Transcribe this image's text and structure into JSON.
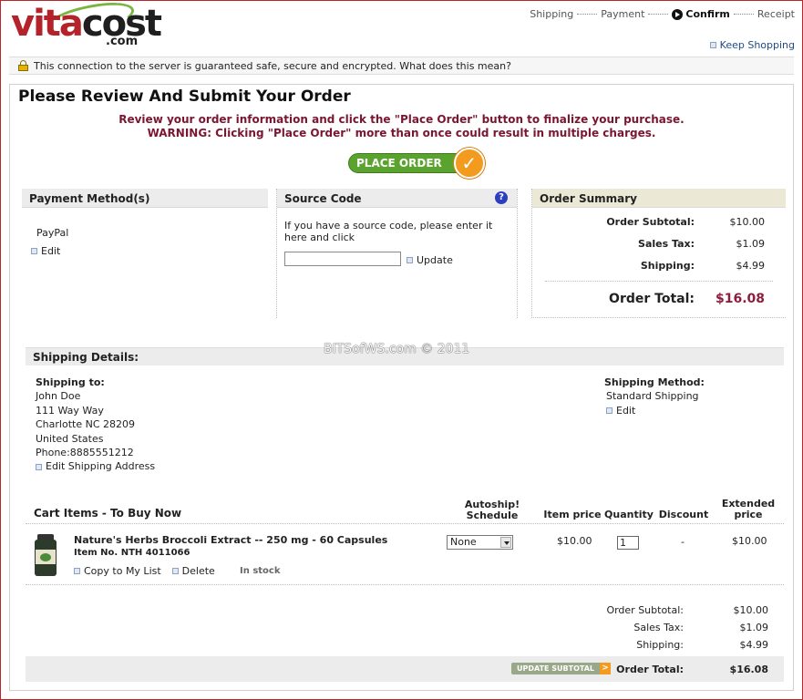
{
  "logo": {
    "word_red": "vita",
    "word_dark": "cost",
    "dotcom": ".com"
  },
  "steps": [
    "Shipping",
    "Payment",
    "Confirm",
    "Receipt"
  ],
  "keep_shopping": "Keep Shopping",
  "security_text": "This connection to the server is guaranteed safe, secure and encrypted. What does this mean?",
  "page_title": "Please Review And Submit Your Order",
  "notice_line1": "Review your order information and click the \"Place Order\" button to finalize your purchase.",
  "notice_line2": "WARNING: Clicking \"Place Order\" more than once could result in multiple charges.",
  "place_order_label": "PLACE ORDER",
  "payment": {
    "title": "Payment Method(s)",
    "method": "PayPal",
    "edit": "Edit"
  },
  "source_code": {
    "title": "Source Code",
    "desc": "If you have a source code, please enter it here and click",
    "value": "",
    "update": "Update"
  },
  "summary": {
    "title": "Order Summary",
    "subtotal_label": "Order Subtotal:",
    "subtotal": "$10.00",
    "tax_label": "Sales Tax:",
    "tax": "$1.09",
    "shipping_label": "Shipping:",
    "shipping": "$4.99",
    "total_label": "Order Total:",
    "total": "$16.08"
  },
  "watermark": "BITSofWS.com © 2011",
  "shipping_details": {
    "title": "Shipping Details:",
    "to_label": "Shipping to:",
    "name": "John Doe",
    "street": "111 Way Way",
    "city": "Charlotte NC 28209",
    "country": "United States",
    "phone": "Phone:8885551212",
    "edit_address": "Edit Shipping Address",
    "method_label": "Shipping Method:",
    "method": "Standard Shipping",
    "method_edit": "Edit"
  },
  "cart": {
    "title": "Cart Items - To Buy Now",
    "headers": {
      "autoship": [
        "Autoship!",
        "Schedule"
      ],
      "price": "Item price",
      "qty": "Quantity",
      "discount": "Discount",
      "extended": [
        "Extended",
        "price"
      ]
    },
    "item": {
      "name": "Nature's Herbs Broccoli Extract -- 250 mg - 60 Capsules",
      "item_no": "Item No. NTH 4011066",
      "copy": "Copy to My List",
      "delete": "Delete",
      "stock": "In stock",
      "autoship": "None",
      "price": "$10.00",
      "qty": "1",
      "discount": "-",
      "extended": "$10.00"
    },
    "totals": {
      "subtotal_label": "Order Subtotal:",
      "subtotal": "$10.00",
      "tax_label": "Sales Tax:",
      "tax": "$1.09",
      "shipping_label": "Shipping:",
      "shipping": "$4.99",
      "total_label": "Order Total:",
      "total": "$16.08"
    },
    "update_subtotal": "UPDATE SUBTOTAL"
  }
}
